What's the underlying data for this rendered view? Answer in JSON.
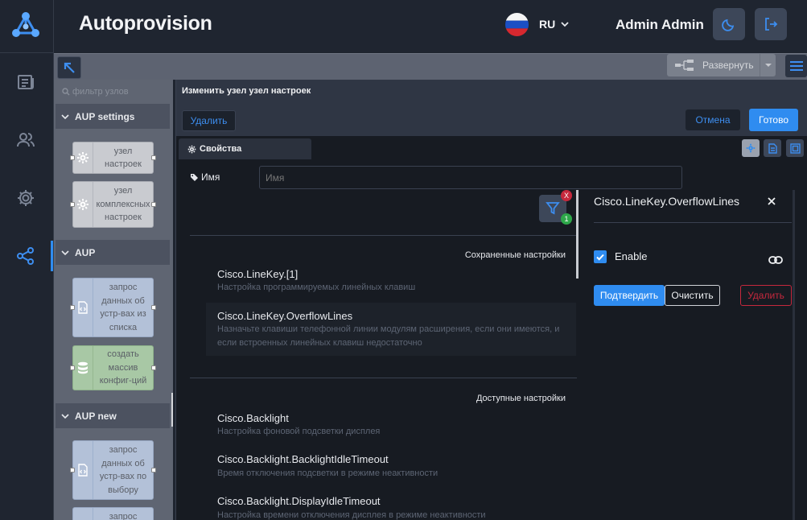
{
  "header": {
    "title": "Autoprovision",
    "language": "RU",
    "user": "Admin Admin"
  },
  "toolbar": {
    "expand_label": "Развернуть"
  },
  "palette": {
    "filter_placeholder": "фильтр узлов",
    "categories": [
      {
        "label": "AUP settings",
        "nodes": [
          {
            "label": "узел настроек"
          },
          {
            "label": "узел комплексных настроек"
          }
        ]
      },
      {
        "label": "AUP",
        "nodes": [
          {
            "label": "запрос данных об устр-вах из списка"
          },
          {
            "label": "создать массив конфиг-ций"
          }
        ]
      },
      {
        "label": "AUP new",
        "nodes": [
          {
            "label": "запрос данных об устр-вах по выбору"
          },
          {
            "label": "запрос"
          }
        ]
      }
    ]
  },
  "editor": {
    "title": "Изменить узел узел настроек",
    "delete_label": "Удалить",
    "cancel_label": "Отмена",
    "done_label": "Готово",
    "tab_label": "Свойства",
    "name_label": "Имя",
    "name_placeholder": "Имя",
    "filter_badge_x": "X",
    "filter_badge_count": "1",
    "saved_heading": "Сохраненные настройки",
    "saved": [
      {
        "name": "Cisco.LineKey.[1]",
        "desc": "Настройка программируемых линейных клавиш"
      },
      {
        "name": "Cisco.LineKey.OverflowLines",
        "desc": "Назначьте клавиши телефонной линии модулям расширения, если они имеются, и если встроенных линейных клавиш недостаточно"
      }
    ],
    "available_heading": "Доступные настройки",
    "available": [
      {
        "name": "Cisco.Backlight",
        "desc": "Настройка фоновой подсветки дисплея"
      },
      {
        "name": "Cisco.Backlight.BacklightIdleTimeout",
        "desc": "Время отключения подсветки в режиме неактивности"
      },
      {
        "name": "Cisco.Backlight.DisplayIdleTimeout",
        "desc": "Настройка времени отключения дисплея в режиме неактивности"
      }
    ]
  },
  "detail": {
    "title": "Cisco.LineKey.OverflowLines",
    "enable_label": "Enable",
    "enabled": true,
    "confirm_label": "Подтвердить",
    "clear_label": "Очистить",
    "delete_label": "Удалить"
  },
  "colors": {
    "accent": "#2f8cf0",
    "danger": "#c6283d",
    "success": "#2ea84a"
  }
}
